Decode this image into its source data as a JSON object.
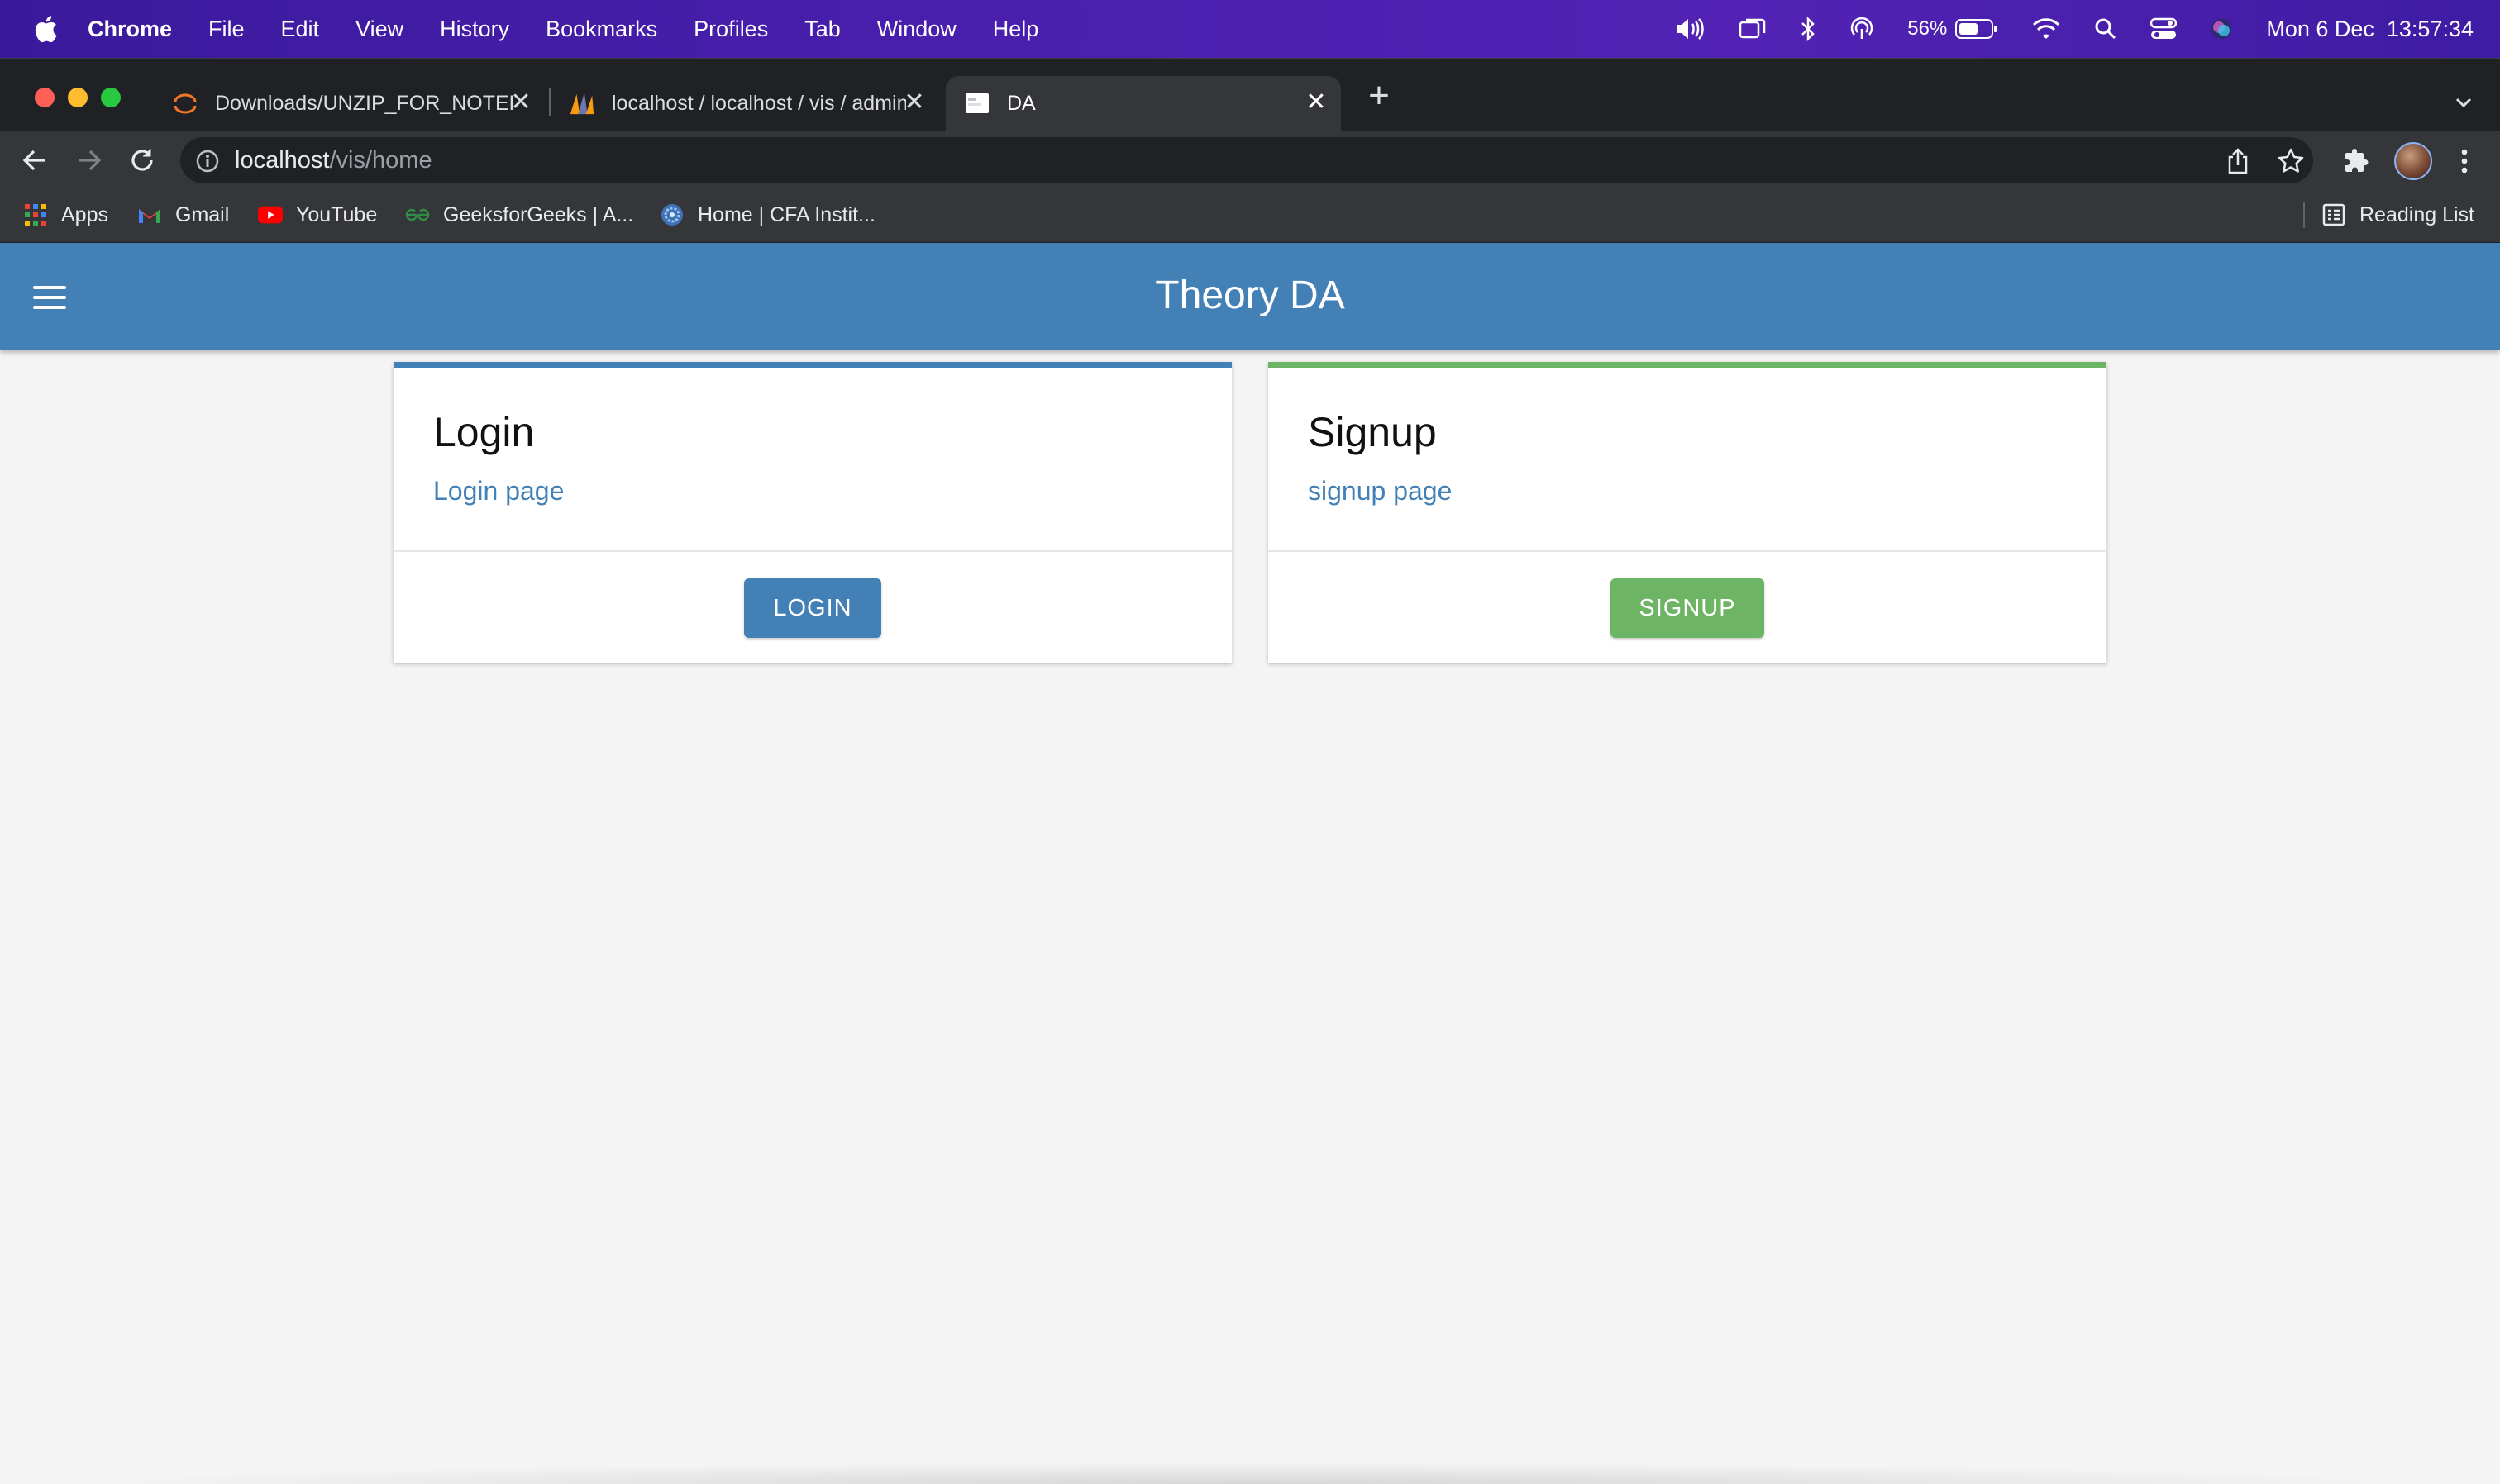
{
  "menubar": {
    "app": "Chrome",
    "items": [
      "File",
      "Edit",
      "View",
      "History",
      "Bookmarks",
      "Profiles",
      "Tab",
      "Window",
      "Help"
    ],
    "battery": "56%",
    "datetime": "Mon 6 Dec  13:57:34"
  },
  "tabs": [
    {
      "title": "Downloads/UNZIP_FOR_NOTEBOOKS",
      "icon": "jupyter-icon"
    },
    {
      "title": "localhost / localhost / vis / admin",
      "icon": "phpmyadmin-icon"
    },
    {
      "title": "DA",
      "icon": "page-icon",
      "active": true
    }
  ],
  "omnibox": {
    "host": "localhost",
    "path": "/vis/home"
  },
  "bookmarks": {
    "items": [
      {
        "label": "Apps",
        "icon": "apps-grid-icon"
      },
      {
        "label": "Gmail",
        "icon": "gmail-icon"
      },
      {
        "label": "YouTube",
        "icon": "youtube-icon"
      },
      {
        "label": "GeeksforGeeks | A...",
        "icon": "gfg-icon"
      },
      {
        "label": "Home | CFA Instit...",
        "icon": "cfa-icon"
      }
    ],
    "reading_list": "Reading List"
  },
  "app": {
    "title": "Theory DA",
    "colors": {
      "primary": "#4380b6",
      "success": "#6db564"
    }
  },
  "cards": [
    {
      "title": "Login",
      "link": "Login page",
      "button": "LOGIN",
      "accent": "#4380b6"
    },
    {
      "title": "Signup",
      "link": "signup page",
      "button": "SIGNUP",
      "accent": "#6db564"
    }
  ]
}
